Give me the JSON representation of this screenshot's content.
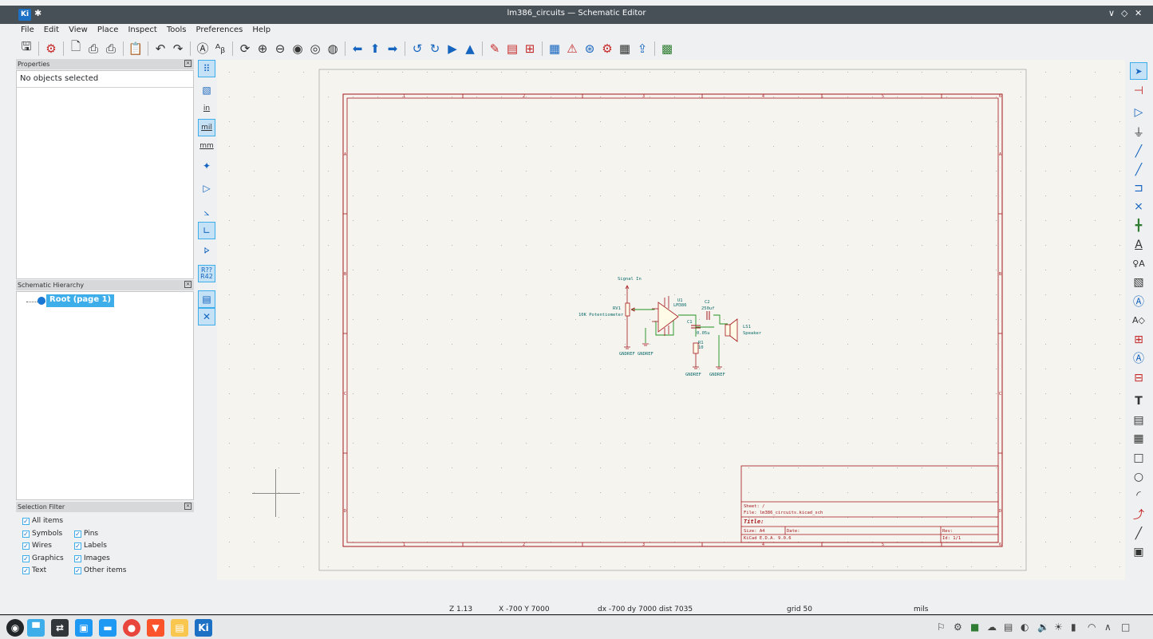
{
  "window": {
    "title": "lm386_circuits — Schematic Editor",
    "app_logo": "Ki",
    "controls": [
      "∨",
      "◇",
      "✕"
    ]
  },
  "menubar": [
    "File",
    "Edit",
    "View",
    "Place",
    "Inspect",
    "Tools",
    "Preferences",
    "Help"
  ],
  "panels": {
    "properties": {
      "header": "Properties",
      "empty_text": "No objects selected"
    },
    "hierarchy": {
      "header": "Schematic Hierarchy",
      "root_label": "Root (page 1)"
    },
    "selection_filter": {
      "header": "Selection Filter",
      "items": [
        {
          "label": "All items",
          "checked": true
        },
        {
          "label": "Symbols",
          "checked": true
        },
        {
          "label": "Pins",
          "checked": true
        },
        {
          "label": "Wires",
          "checked": true
        },
        {
          "label": "Labels",
          "checked": true
        },
        {
          "label": "Graphics",
          "checked": true
        },
        {
          "label": "Images",
          "checked": true
        },
        {
          "label": "Text",
          "checked": true
        },
        {
          "label": "Other items",
          "checked": true
        }
      ]
    }
  },
  "left_toolbar": {
    "units": {
      "in": "in",
      "mil": "mil",
      "mm": "mm"
    },
    "annotate": "R??\nR42"
  },
  "schematic": {
    "border_cols": [
      "1",
      "2",
      "3",
      "4",
      "5",
      "6"
    ],
    "border_rows": [
      "A",
      "B",
      "C",
      "D"
    ],
    "components": {
      "signal_in": "Signal In",
      "rv1_ref": "RV1",
      "rv1_val": "10K Potentiometer",
      "u1_ref": "U1",
      "u1_val": "LM386",
      "c2_ref": "C2",
      "c2_val": "250uf",
      "c1_ref": "C1",
      "c1_val": "0.05u",
      "r1_ref": "R1",
      "r1_val": "10",
      "ls1_ref": "LS1",
      "ls1_val": "Speaker",
      "gnd1": "GNDREF",
      "gnd2": "GNDREF",
      "gnd3": "GNDREF",
      "gnd4": "GNDREF"
    },
    "title_block": {
      "sheet": "Sheet: /",
      "file": "File: lm386_circuits.kicad_sch",
      "title": "Title:",
      "size": "Size: A4",
      "date": "Date:",
      "rev": "Rev:",
      "kicad": "KiCad E.D.A. 9.0.6",
      "id": "Id: 1/1"
    }
  },
  "statusbar": {
    "zoom": "Z 1.13",
    "xy": "X -700  Y 7000",
    "delta": "dx -700  dy 7000  dist 7035",
    "grid": "grid 50",
    "units": "mils"
  }
}
